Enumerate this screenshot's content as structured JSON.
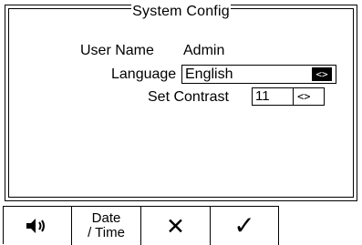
{
  "screen": {
    "title": "System Config",
    "fields": {
      "user_name_label": "User Name",
      "user_name_value": "Admin",
      "language_label": "Language",
      "language_value": "English",
      "language_arrow": "<>",
      "contrast_label": "Set Contrast",
      "contrast_value": "11",
      "contrast_arrow": "<>"
    }
  },
  "softkeys": {
    "volume_icon": "speaker-icon",
    "date_time_line1": "Date",
    "date_time_line2": "/ Time",
    "cancel_icon": "close-icon",
    "confirm_icon": "check-icon"
  },
  "colors": {
    "foreground": "#000000",
    "background": "#ffffff"
  }
}
